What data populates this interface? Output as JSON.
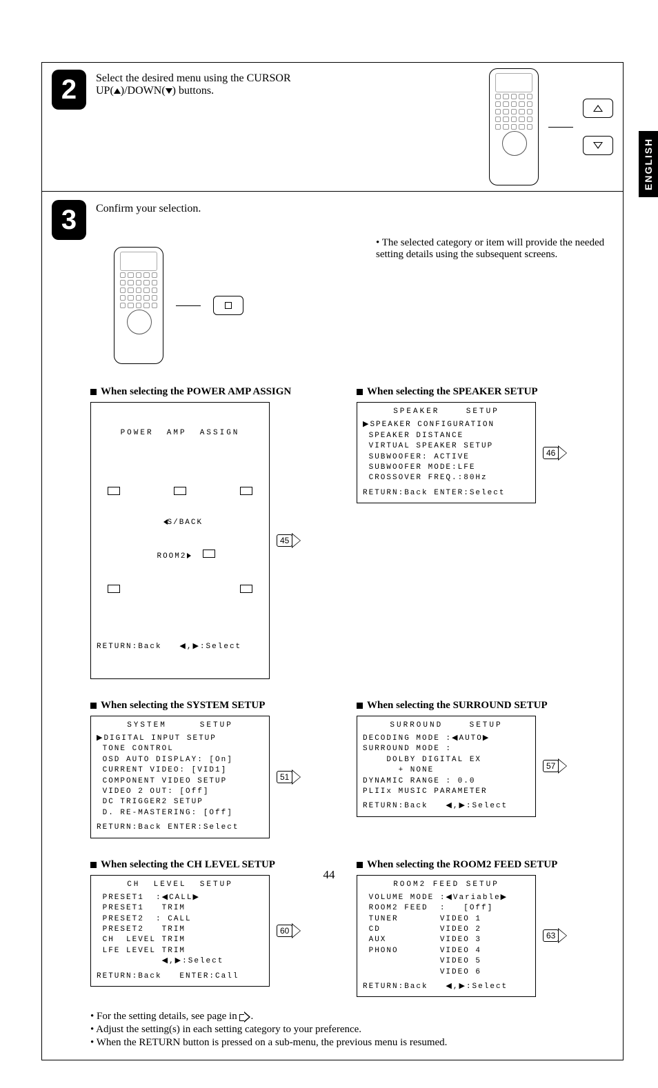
{
  "side_tab": "ENGLISH",
  "page_number": "44",
  "step2": {
    "num": "2",
    "text_a": "Select the desired menu using the CURSOR",
    "text_b": "UP(",
    "text_c": ")/DOWN(",
    "text_d": ") buttons."
  },
  "step3": {
    "num": "3",
    "text": "Confirm your selection.",
    "note": "• The selected category or item will provide the needed setting details using the subsequent screens."
  },
  "sections": {
    "power_amp": {
      "head": "When selecting the POWER AMP ASSIGN",
      "title": "POWER  AMP  ASSIGN",
      "line1": "S/BACK",
      "line2": "ROOM2",
      "footer": "RETURN:Back   ◀,▶:Select",
      "ref": "45"
    },
    "speaker": {
      "head": "When selecting the SPEAKER SETUP",
      "title": "SPEAKER    SETUP",
      "lines": [
        "▶SPEAKER CONFIGURATION",
        " SPEAKER DISTANCE",
        " VIRTUAL SPEAKER SETUP",
        " SUBWOOFER: ACTIVE",
        " SUBWOOFER MODE:LFE",
        " CROSSOVER FREQ.:80Hz"
      ],
      "footer": "RETURN:Back ENTER:Select",
      "ref": "46"
    },
    "system": {
      "head": "When selecting the SYSTEM SETUP",
      "title": "SYSTEM     SETUP",
      "lines": [
        "▶DIGITAL INPUT SETUP",
        " TONE CONTROL",
        " OSD AUTO DISPLAY: [On]",
        " CURRENT VIDEO: [VID1]",
        " COMPONENT VIDEO SETUP",
        " VIDEO 2 OUT: [Off]",
        " DC TRIGGER2 SETUP",
        " D. RE-MASTERING: [Off]"
      ],
      "footer": "RETURN:Back ENTER:Select",
      "ref": "51"
    },
    "surround": {
      "head": "When selecting the SURROUND SETUP",
      "title": "SURROUND    SETUP",
      "lines": [
        "DECODING MODE :◀AUTO▶",
        "SURROUND MODE :",
        "    DOLBY DIGITAL EX",
        "      + NONE",
        "DYNAMIC RANGE : 0.0",
        "PLIIx MUSIC PARAMETER"
      ],
      "footer": "RETURN:Back   ◀,▶:Select",
      "ref": "57"
    },
    "chlevel": {
      "head": "When selecting the CH LEVEL SETUP",
      "title": "CH  LEVEL  SETUP",
      "lines": [
        " PRESET1  :◀CALL▶",
        " PRESET1   TRIM",
        " PRESET2  : CALL",
        " PRESET2   TRIM",
        " CH  LEVEL TRIM",
        " LFE LEVEL TRIM",
        "           ◀,▶:Select"
      ],
      "footer": "RETURN:Back   ENTER:Call",
      "ref": "60"
    },
    "room2": {
      "head": "When selecting the ROOM2 FEED SETUP",
      "title": "ROOM2 FEED SETUP",
      "lines": [
        " VOLUME MODE :◀Variable▶",
        " ROOM2 FEED  :   [Off]",
        " TUNER       VIDEO 1",
        " CD          VIDEO 2",
        " AUX         VIDEO 3",
        " PHONO       VIDEO 4",
        "             VIDEO 5",
        "             VIDEO 6"
      ],
      "footer": "RETURN:Back   ◀,▶:Select",
      "ref": "63"
    }
  },
  "notes": {
    "n1a": "• For the setting details, see page in ",
    "n1b": ".",
    "n2": "• Adjust the setting(s) in each setting category to your preference.",
    "n3": "• When the RETURN button is pressed on a sub-menu, the previous menu is resumed."
  }
}
